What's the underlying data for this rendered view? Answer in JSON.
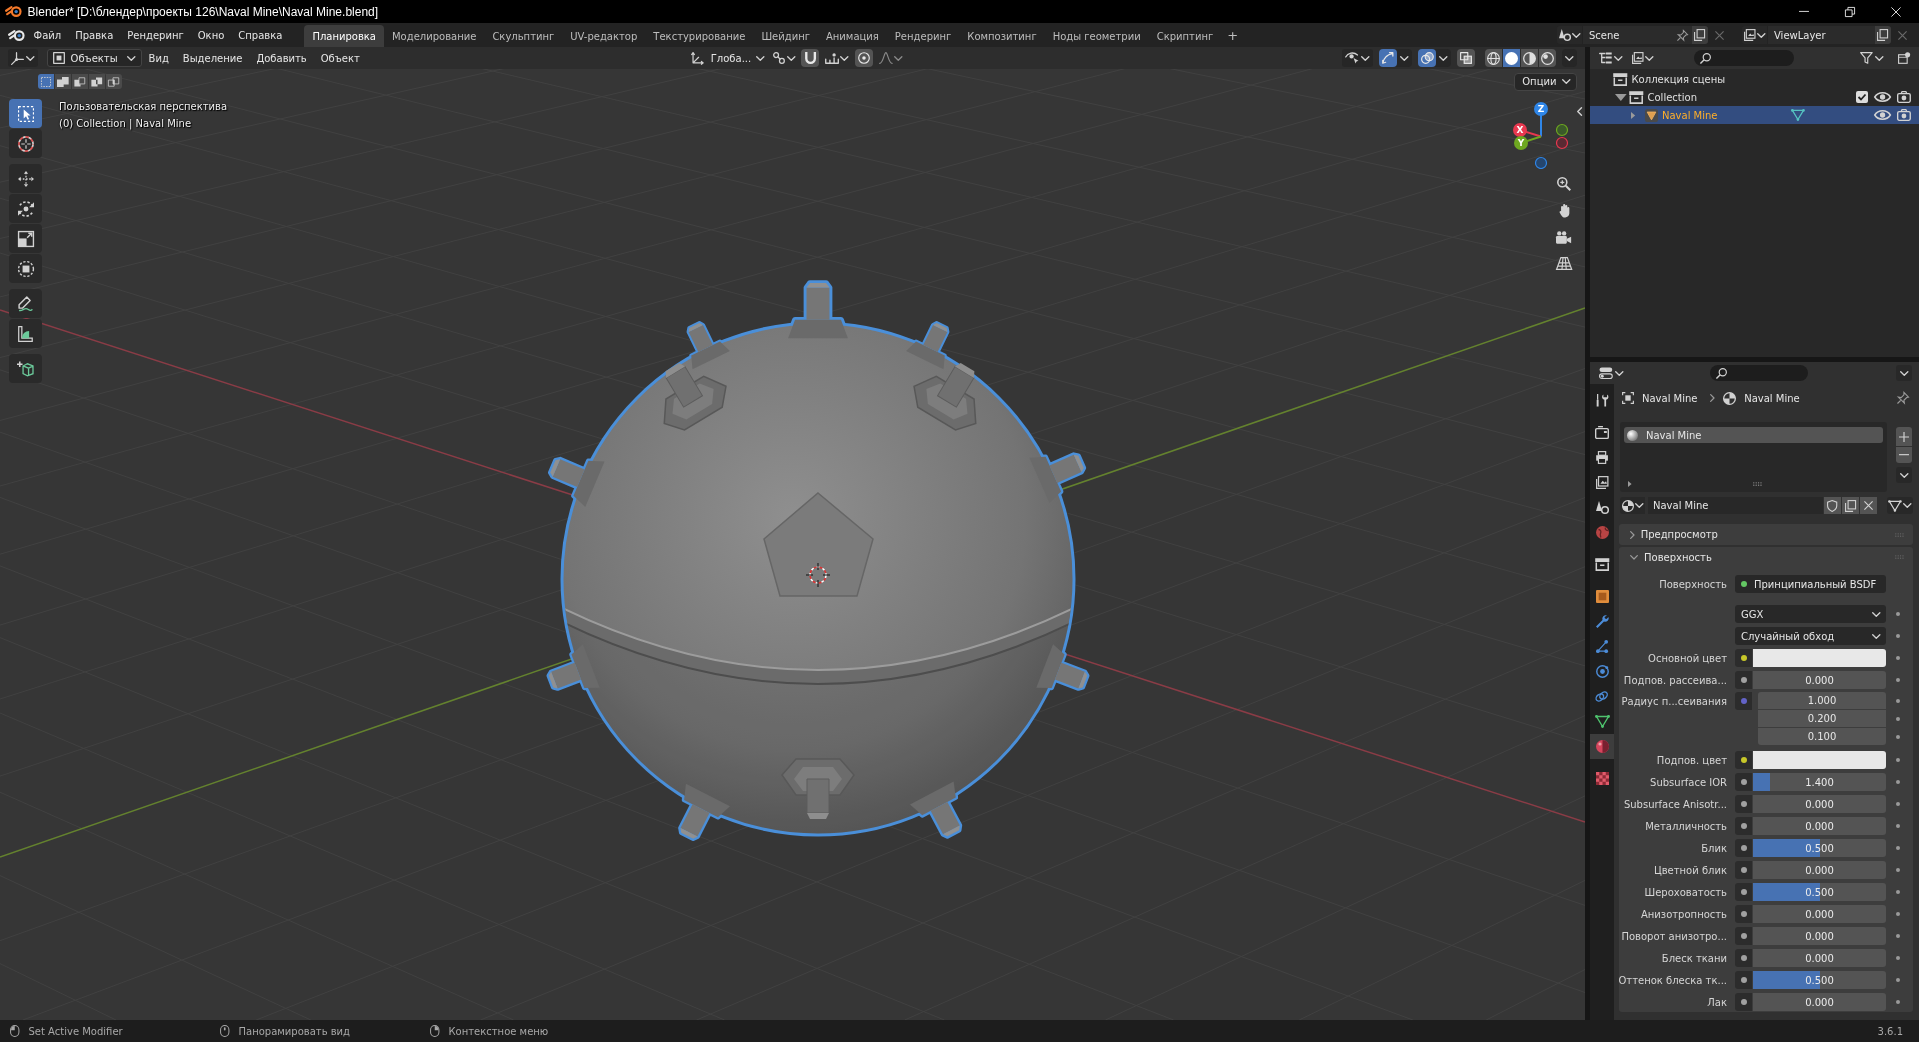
{
  "window": {
    "title": "Blender* [D:\\блендер\\проекты 126\\Naval Mine\\Naval Mine.blend]"
  },
  "menu": [
    "Файл",
    "Правка",
    "Рендеринг",
    "Окно",
    "Справка"
  ],
  "workspaces": [
    {
      "label": "Планировка",
      "selected": true
    },
    {
      "label": "Моделирование",
      "selected": false
    },
    {
      "label": "Скульптинг",
      "selected": false
    },
    {
      "label": "UV-редактор",
      "selected": false
    },
    {
      "label": "Текстурирование",
      "selected": false
    },
    {
      "label": "Шейдинг",
      "selected": false
    },
    {
      "label": "Анимация",
      "selected": false
    },
    {
      "label": "Рендеринг",
      "selected": false
    },
    {
      "label": "Композитинг",
      "selected": false
    },
    {
      "label": "Ноды геометрии",
      "selected": false
    },
    {
      "label": "Скриптинг",
      "selected": false
    }
  ],
  "add_workspace": "+",
  "scene": "Scene",
  "view_layer": "ViewLayer",
  "viewport": {
    "mode": "Объекты",
    "menus": [
      "Вид",
      "Выделение",
      "Добавить",
      "Объект"
    ],
    "orientation": "Глоба...",
    "snap": {
      "on": false
    },
    "proportional": {
      "on": false
    },
    "gizmos": {
      "on": true
    },
    "overlays": {
      "on": true
    },
    "xray": {
      "on": false
    },
    "shading": [
      {
        "kind": "wireframe",
        "selected": false
      },
      {
        "kind": "solid",
        "selected": true
      },
      {
        "kind": "material",
        "selected": false
      },
      {
        "kind": "rendered",
        "selected": false
      }
    ],
    "select_modes": [
      {
        "kind": "set",
        "selected": true
      },
      {
        "kind": "extend",
        "selected": false
      },
      {
        "kind": "subtract",
        "selected": false
      },
      {
        "kind": "difference",
        "selected": false
      },
      {
        "kind": "intersect",
        "selected": false
      }
    ],
    "options": "Опции",
    "view_name": "Пользовательская перспектива",
    "object_info": "(0) Collection | Naval Mine",
    "tools": [
      {
        "kind": "select_box",
        "selected": true
      },
      {
        "kind": "cursor",
        "selected": false
      },
      {
        "kind": "move",
        "selected": false
      },
      {
        "kind": "rotate",
        "selected": false
      },
      {
        "kind": "scale",
        "selected": false
      },
      {
        "kind": "transform",
        "selected": false
      },
      {
        "kind": "annotate",
        "selected": false
      },
      {
        "kind": "measure",
        "selected": false
      },
      {
        "kind": "add_cube",
        "selected": false
      }
    ],
    "gizmo_axes": [
      {
        "label": "Z",
        "color": "#2f86e8"
      },
      {
        "label": "X",
        "color": "#e8384f"
      },
      {
        "label": "Y",
        "color": "#6ea820"
      }
    ]
  },
  "outliner": {
    "tree": [
      {
        "label": "Коллекция сцены",
        "kind": "scene_collection",
        "selected": false,
        "children": [
          {
            "label": "Collection",
            "kind": "collection",
            "selected": false,
            "expanded": true,
            "checked": true,
            "visible": true,
            "renderable": true,
            "children": [
              {
                "label": "Naval Mine",
                "kind": "mesh_object",
                "selected": true,
                "expanded": false,
                "visible": true,
                "renderable": true
              }
            ]
          }
        ]
      }
    ]
  },
  "properties": {
    "tabs": [
      {
        "kind": "tool",
        "selected": false
      },
      {
        "kind": "render",
        "selected": false
      },
      {
        "kind": "output",
        "selected": false
      },
      {
        "kind": "view_layer",
        "selected": false
      },
      {
        "kind": "scene",
        "selected": false
      },
      {
        "kind": "world",
        "selected": false
      },
      {
        "kind": "collection",
        "selected": false
      },
      {
        "kind": "object",
        "selected": false
      },
      {
        "kind": "modifier",
        "selected": false
      },
      {
        "kind": "particles",
        "selected": false
      },
      {
        "kind": "physics",
        "selected": false
      },
      {
        "kind": "constraints",
        "selected": false
      },
      {
        "kind": "data",
        "selected": false
      },
      {
        "kind": "material",
        "selected": true
      },
      {
        "kind": "texture",
        "selected": false
      }
    ],
    "breadcrumb": [
      "Naval Mine",
      "Naval Mine"
    ],
    "material_slots": [
      {
        "name": "Naval Mine",
        "selected": true
      }
    ],
    "material": "Naval Mine",
    "panels": [
      {
        "title": "Предпросмотр",
        "expanded": false
      },
      {
        "title": "Поверхность",
        "expanded": true,
        "rows": [
          {
            "kind": "shader",
            "label": "Поверхность",
            "value": "Принципиальный BSDF",
            "socket": {
              "color": "#63c763"
            }
          },
          {
            "kind": "enum",
            "value": "GGX"
          },
          {
            "kind": "enum",
            "value": "Случайный обход"
          },
          {
            "kind": "color",
            "label": "Основной цвет",
            "socket": {
              "color": "#c7c729"
            },
            "swatch": {
              "color": "#e8e8e8"
            }
          },
          {
            "kind": "slider",
            "label": "Подпов. рассеива...",
            "socket": {
              "color": "#a1a1a1"
            },
            "value": "0.000"
          },
          {
            "kind": "vector",
            "label": "Радиус п...сеивания",
            "socket": {
              "color": "#6363c7"
            },
            "values": [
              "1.000",
              "0.200",
              "0.100"
            ]
          },
          {
            "kind": "color",
            "label": "Подпов. цвет",
            "socket": {
              "color": "#c7c729"
            },
            "swatch": {
              "color": "#e8e8e8"
            }
          },
          {
            "kind": "slider",
            "label": "Subsurface IOR",
            "socket": {
              "color": "#a1a1a1"
            },
            "value": "1.400",
            "level": 0.13
          },
          {
            "kind": "slider",
            "label": "Subsurface Anisotr...",
            "socket": {
              "color": "#a1a1a1"
            },
            "value": "0.000"
          },
          {
            "kind": "slider",
            "label": "Металличность",
            "socket": {
              "color": "#a1a1a1"
            },
            "value": "0.000"
          },
          {
            "kind": "slider",
            "label": "Блик",
            "socket": {
              "color": "#a1a1a1"
            },
            "value": "0.500",
            "level": 0.5
          },
          {
            "kind": "slider",
            "label": "Цветной блик",
            "socket": {
              "color": "#a1a1a1"
            },
            "value": "0.000"
          },
          {
            "kind": "slider",
            "label": "Шероховатость",
            "socket": {
              "color": "#a1a1a1"
            },
            "value": "0.500",
            "level": 0.5
          },
          {
            "kind": "slider",
            "label": "Анизотропность",
            "socket": {
              "color": "#a1a1a1"
            },
            "value": "0.000"
          },
          {
            "kind": "slider",
            "label": "Поворот анизотро...",
            "socket": {
              "color": "#a1a1a1"
            },
            "value": "0.000"
          },
          {
            "kind": "slider",
            "label": "Блеск ткани",
            "socket": {
              "color": "#a1a1a1"
            },
            "value": "0.000"
          },
          {
            "kind": "slider",
            "label": "Оттенок блеска тк...",
            "socket": {
              "color": "#a1a1a1"
            },
            "value": "0.500",
            "level": 0.5
          },
          {
            "kind": "slider",
            "label": "Лак",
            "socket": {
              "color": "#a1a1a1"
            },
            "value": "0.000"
          }
        ]
      }
    ]
  },
  "status_bar": {
    "items": [
      {
        "kind": "left_click",
        "label": "Set Active Modifier"
      },
      {
        "kind": "middle_click",
        "label": "Панорамировать вид"
      },
      {
        "kind": "right_click",
        "label": "Контекстное меню"
      }
    ],
    "version": "3.6.1"
  }
}
